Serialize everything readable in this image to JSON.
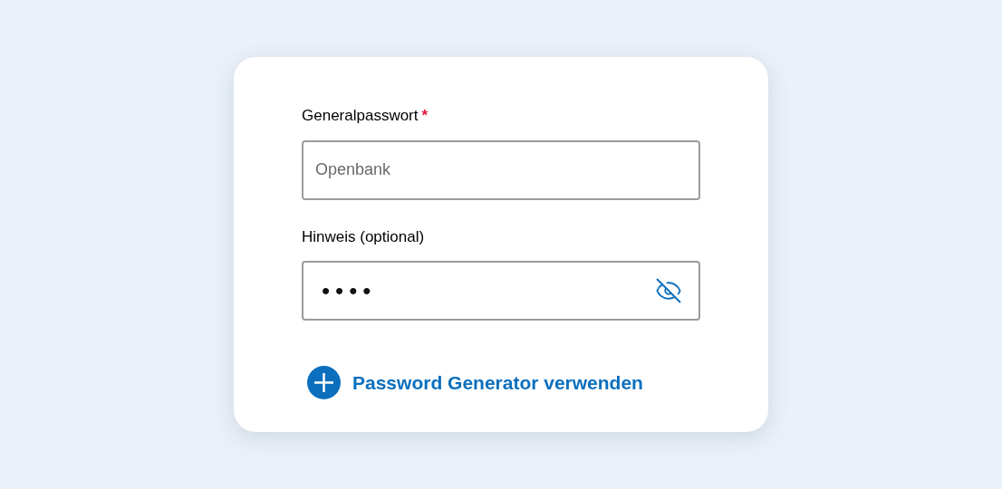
{
  "fields": [
    {
      "label": "Generalpasswort",
      "required_mark": "*",
      "placeholder": "Openbank",
      "kind": "text"
    },
    {
      "label": "Hinweis (optional)",
      "value": "••••",
      "kind": "password",
      "masked": true
    }
  ],
  "action": {
    "label": "Password Generator verwenden"
  }
}
